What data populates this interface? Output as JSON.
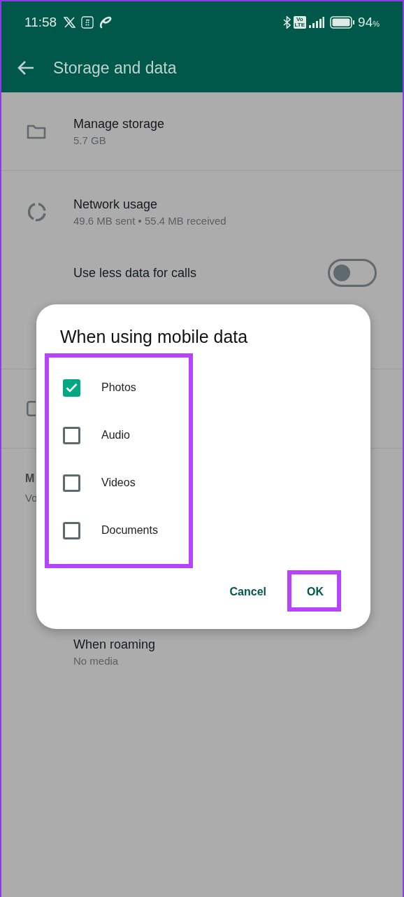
{
  "status_bar": {
    "time": "11:58",
    "volte": [
      "Vo",
      "LTE"
    ],
    "battery": "94",
    "battery_unit": "%"
  },
  "app_bar": {
    "title": "Storage and data"
  },
  "settings": [
    {
      "kind": "detail",
      "title": "Manage storage",
      "subtitle": "5.7 GB"
    },
    {
      "kind": "detail",
      "title": "Network usage",
      "subtitle": "49.6 MB sent • 55.4 MB received"
    },
    {
      "kind": "toggle",
      "title": "Use less data for calls",
      "on": false
    }
  ],
  "partial_section": {
    "header": "M",
    "subtitle": "Vo"
  },
  "roaming": {
    "title": "When roaming",
    "subtitle": "No media"
  },
  "dialog": {
    "title": "When using mobile data",
    "options": [
      {
        "label": "Photos",
        "checked": true
      },
      {
        "label": "Audio",
        "checked": false
      },
      {
        "label": "Videos",
        "checked": false
      },
      {
        "label": "Documents",
        "checked": false
      }
    ],
    "buttons": [
      "Cancel",
      "OK"
    ]
  }
}
